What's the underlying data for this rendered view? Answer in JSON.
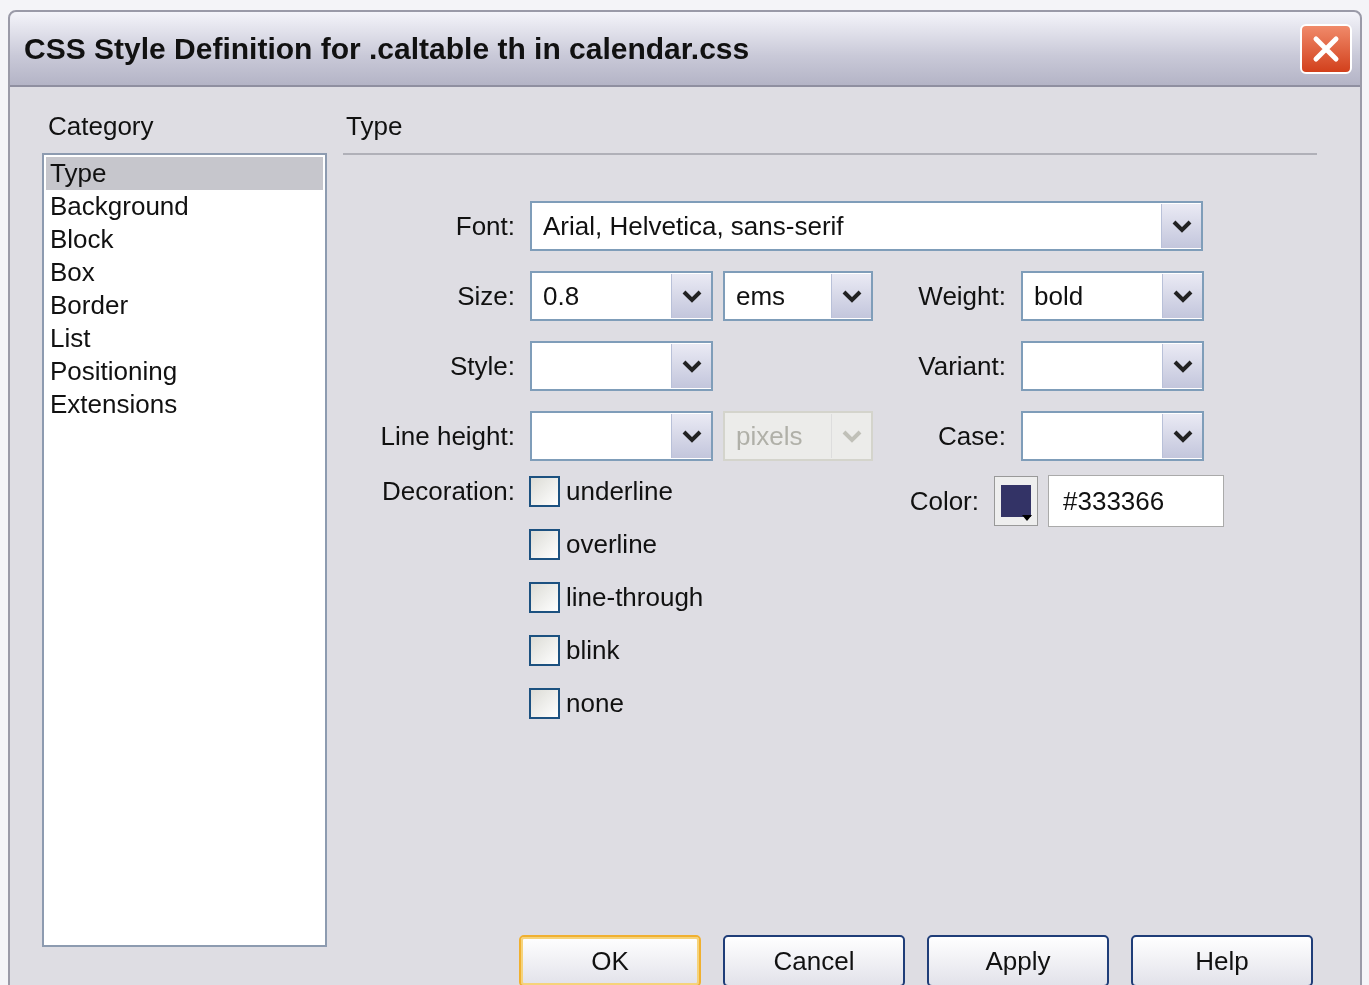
{
  "window": {
    "title": "CSS Style Definition for .caltable th in calendar.css"
  },
  "category_label": "Category",
  "categories": [
    {
      "label": "Type",
      "selected": true
    },
    {
      "label": "Background",
      "selected": false
    },
    {
      "label": "Block",
      "selected": false
    },
    {
      "label": "Box",
      "selected": false
    },
    {
      "label": "Border",
      "selected": false
    },
    {
      "label": "List",
      "selected": false
    },
    {
      "label": "Positioning",
      "selected": false
    },
    {
      "label": "Extensions",
      "selected": false
    }
  ],
  "panel_title": "Type",
  "font": {
    "label": "Font:",
    "value": "Arial, Helvetica, sans-serif"
  },
  "size": {
    "label": "Size:",
    "value": "0.8",
    "unit": "ems"
  },
  "weight": {
    "label": "Weight:",
    "value": "bold"
  },
  "style": {
    "label": "Style:"
  },
  "variant": {
    "label": "Variant:"
  },
  "line_height": {
    "label": "Line height:",
    "unit": "pixels",
    "unit_disabled": true
  },
  "case": {
    "label": "Case:"
  },
  "color": {
    "label": "Color:",
    "value": "#333366"
  },
  "decoration": {
    "label": "Decoration:",
    "options": [
      {
        "label": "underline",
        "checked": false
      },
      {
        "label": "overline",
        "checked": false
      },
      {
        "label": "line-through",
        "checked": false
      },
      {
        "label": "blink",
        "checked": false
      },
      {
        "label": "none",
        "checked": false
      }
    ]
  },
  "buttons": [
    {
      "label": "OK",
      "default": true
    },
    {
      "label": "Cancel",
      "default": false
    },
    {
      "label": "Apply",
      "default": false
    },
    {
      "label": "Help",
      "default": false
    }
  ]
}
